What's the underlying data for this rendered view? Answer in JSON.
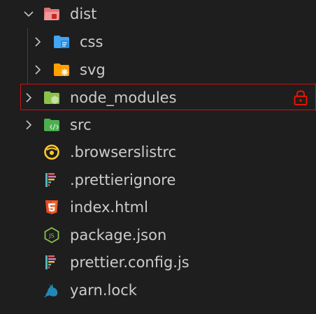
{
  "explorer": {
    "items": [
      {
        "label": "dist",
        "type": "folder-open",
        "icon": "folder-dist-open-icon"
      },
      {
        "label": "css",
        "type": "folder",
        "icon": "folder-css-icon"
      },
      {
        "label": "svg",
        "type": "folder",
        "icon": "folder-svg-icon"
      },
      {
        "label": "node_modules",
        "type": "folder",
        "icon": "folder-node-icon",
        "locked": true
      },
      {
        "label": "src",
        "type": "folder",
        "icon": "folder-src-icon"
      },
      {
        "label": ".browserslistrc",
        "type": "file",
        "icon": "browserslist-icon"
      },
      {
        "label": ".prettierignore",
        "type": "file",
        "icon": "prettier-icon"
      },
      {
        "label": "index.html",
        "type": "file",
        "icon": "html5-icon"
      },
      {
        "label": "package.json",
        "type": "file",
        "icon": "nodejs-icon"
      },
      {
        "label": "prettier.config.js",
        "type": "file",
        "icon": "prettier-icon"
      },
      {
        "label": "yarn.lock",
        "type": "file",
        "icon": "yarn-icon"
      }
    ]
  },
  "colors": {
    "background": "#1e1e1e",
    "text": "#cccccc",
    "selection_border": "#d20f13",
    "lock": "#e51400"
  }
}
